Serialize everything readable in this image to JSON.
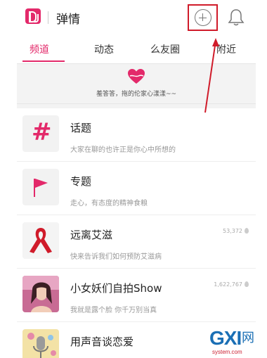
{
  "header": {
    "app_title": "弹情",
    "add_icon": "plus-circle-icon",
    "bell_icon": "bell-icon",
    "highlight_color": "#d01b2a"
  },
  "tabs": [
    {
      "label": "频道",
      "active": true
    },
    {
      "label": "动态",
      "active": false
    },
    {
      "label": "么友圈",
      "active": false
    },
    {
      "label": "附近",
      "active": false
    }
  ],
  "banner": {
    "icon": "heart-icon",
    "text": "羞答答，拖的伦家心漾漾~~"
  },
  "channels": [
    {
      "title": "话题",
      "subtitle": "大家在聊的也许正是你心中所想的",
      "count": "",
      "icon": "hash-icon"
    },
    {
      "title": "专题",
      "subtitle": "走心，有态度的精神食粮",
      "count": "",
      "icon": "flag-icon"
    },
    {
      "title": "远离艾滋",
      "subtitle": "快来告诉我们如何预防艾滋病",
      "count": "53,372",
      "icon": "red-ribbon-icon"
    },
    {
      "title": "小女妖们自拍Show",
      "subtitle": "我就是露个脸 你千万别当真",
      "count": "1,622,767",
      "icon": "selfie-photo"
    },
    {
      "title": "用声音谈恋爱",
      "subtitle": "",
      "count": "",
      "icon": "microphone-image"
    }
  ],
  "watermark": {
    "main": "GXI",
    "suffix": "网",
    "domain": "system.com"
  },
  "colors": {
    "accent": "#e3296a",
    "annotation_red": "#d01b2a"
  }
}
